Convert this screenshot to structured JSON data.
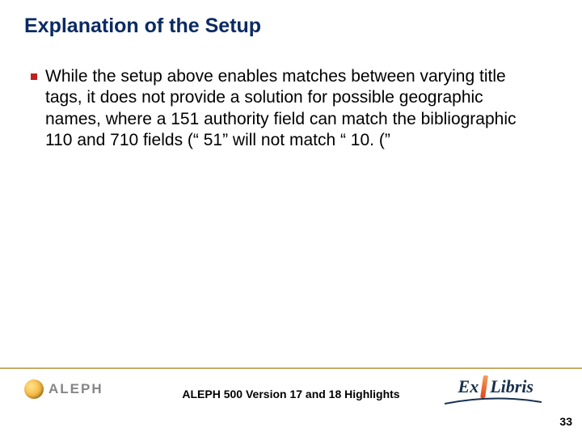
{
  "slide": {
    "title": "Explanation of the Setup",
    "bullets": [
      "While the setup above enables matches between varying title tags, it does not provide a solution for possible geographic names, where a 151 authority field can match the bibliographic 110 and 710 fields (“ 51” will not match “ 10. (”"
    ]
  },
  "footer": {
    "product_left": "ALEPH",
    "center_text": "ALEPH 500 Version 17 and 18 Highlights",
    "product_right_a": "Ex",
    "product_right_b": "Libris",
    "page_number": "33"
  },
  "icons": {
    "bullet": "square-bullet-icon",
    "globe": "globe-icon",
    "exlibris_bar": "exlibris-bar-icon",
    "swoosh": "swoosh-icon"
  }
}
